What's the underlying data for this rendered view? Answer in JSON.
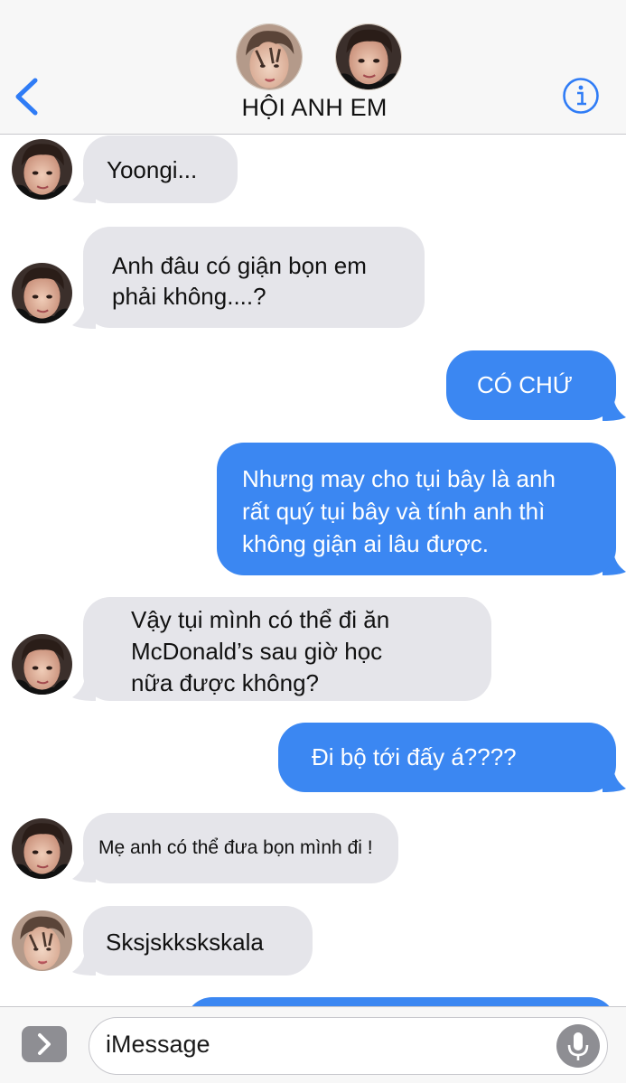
{
  "header": {
    "title": "HỘI ANH EM",
    "back_icon": "chevron-left-icon",
    "info_icon": "info-circle-icon",
    "accent_color": "#2f7cf6"
  },
  "messages": [
    {
      "id": "m1",
      "side": "received",
      "text": "Yoongi...",
      "avatar": "member-b"
    },
    {
      "id": "m2",
      "side": "received",
      "text": "Anh đâu có giận bọn em\nphải không....?",
      "avatar": "member-b"
    },
    {
      "id": "m3",
      "side": "sent",
      "text": "CÓ CHỨ"
    },
    {
      "id": "m4",
      "side": "sent",
      "text": "Nhưng may cho tụi bây là anh\nrất quý tụi bây và tính anh thì\nkhông giận ai lâu được."
    },
    {
      "id": "m5",
      "side": "received",
      "text": "Vậy tụi mình có thể đi ăn\nMcDonald’s sau giờ học\nnữa được không?",
      "avatar": "member-b"
    },
    {
      "id": "m6",
      "side": "sent",
      "text": "Đi bộ tới đấy á????"
    },
    {
      "id": "m7",
      "side": "received",
      "text": "Mẹ anh có thể đưa bọn mình đi !",
      "avatar": "member-b"
    },
    {
      "id": "m8",
      "side": "received",
      "text": "Sksjskkskskala",
      "avatar": "member-a"
    },
    {
      "id": "m9",
      "side": "sent",
      "text": ""
    }
  ],
  "input": {
    "placeholder": "iMessage",
    "apps_icon": "chevron-right-icon",
    "mic_icon": "microphone-icon"
  },
  "colors": {
    "sent_bubble": "#3b87f2",
    "received_bubble": "#e5e5ea",
    "header_bg": "#f7f7f7"
  }
}
